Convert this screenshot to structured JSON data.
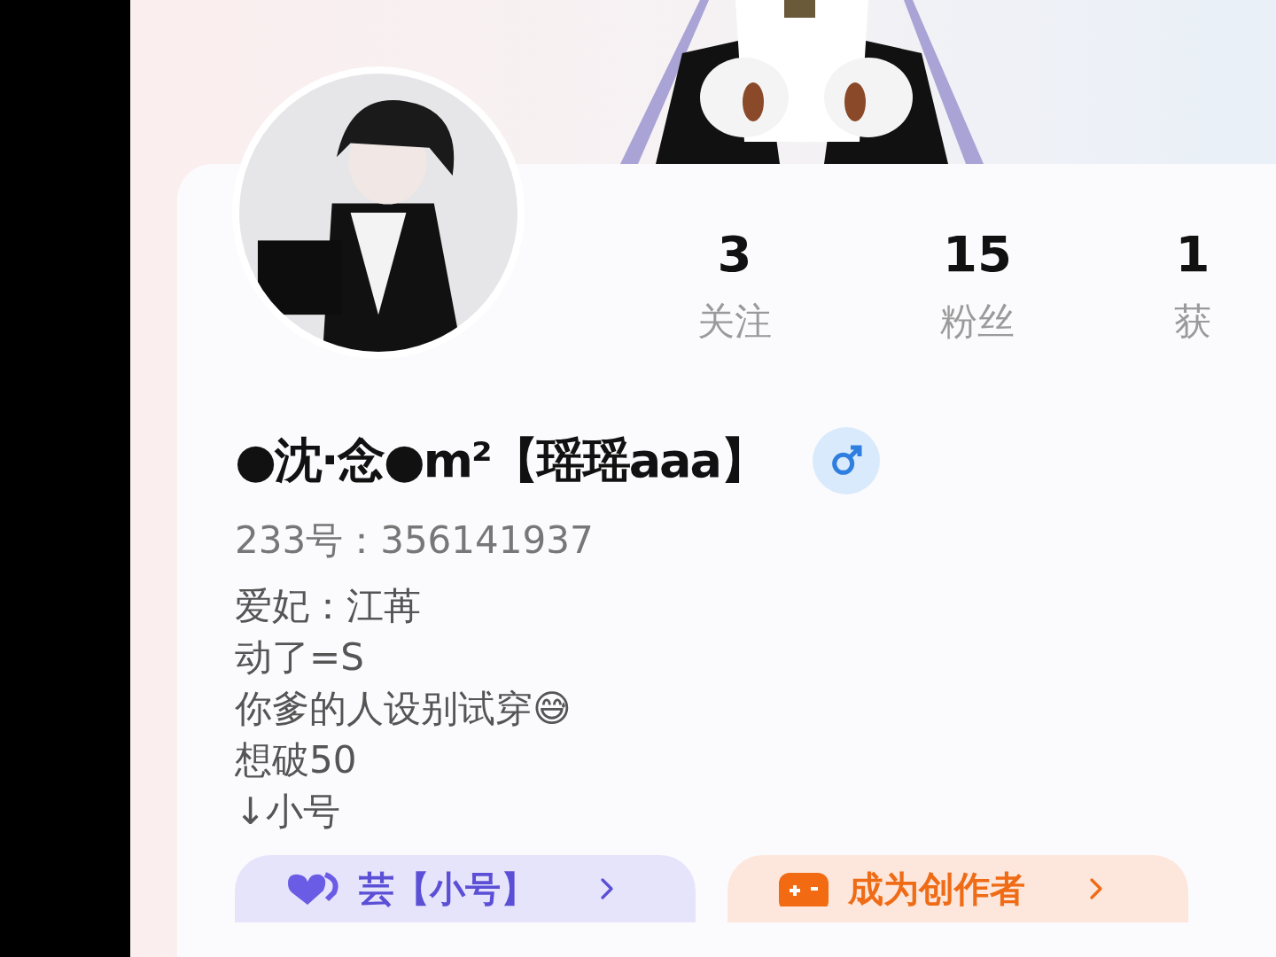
{
  "profile": {
    "name": "●沈·念●m²【瑶瑶aaa】",
    "male": true,
    "id_line": "233号：356141937",
    "bio": [
      "爱妃：江苒",
      "动了=S",
      "你爹的人设别试穿😅",
      "想破50",
      "↓小号"
    ]
  },
  "stats": [
    {
      "value": "3",
      "label": "关注"
    },
    {
      "value": "15",
      "label": "粉丝"
    },
    {
      "value": "1",
      "label": "获"
    }
  ],
  "actions": [
    {
      "kind": "account",
      "label": "芸【小号】"
    },
    {
      "kind": "creator",
      "label": "成为创作者"
    }
  ]
}
